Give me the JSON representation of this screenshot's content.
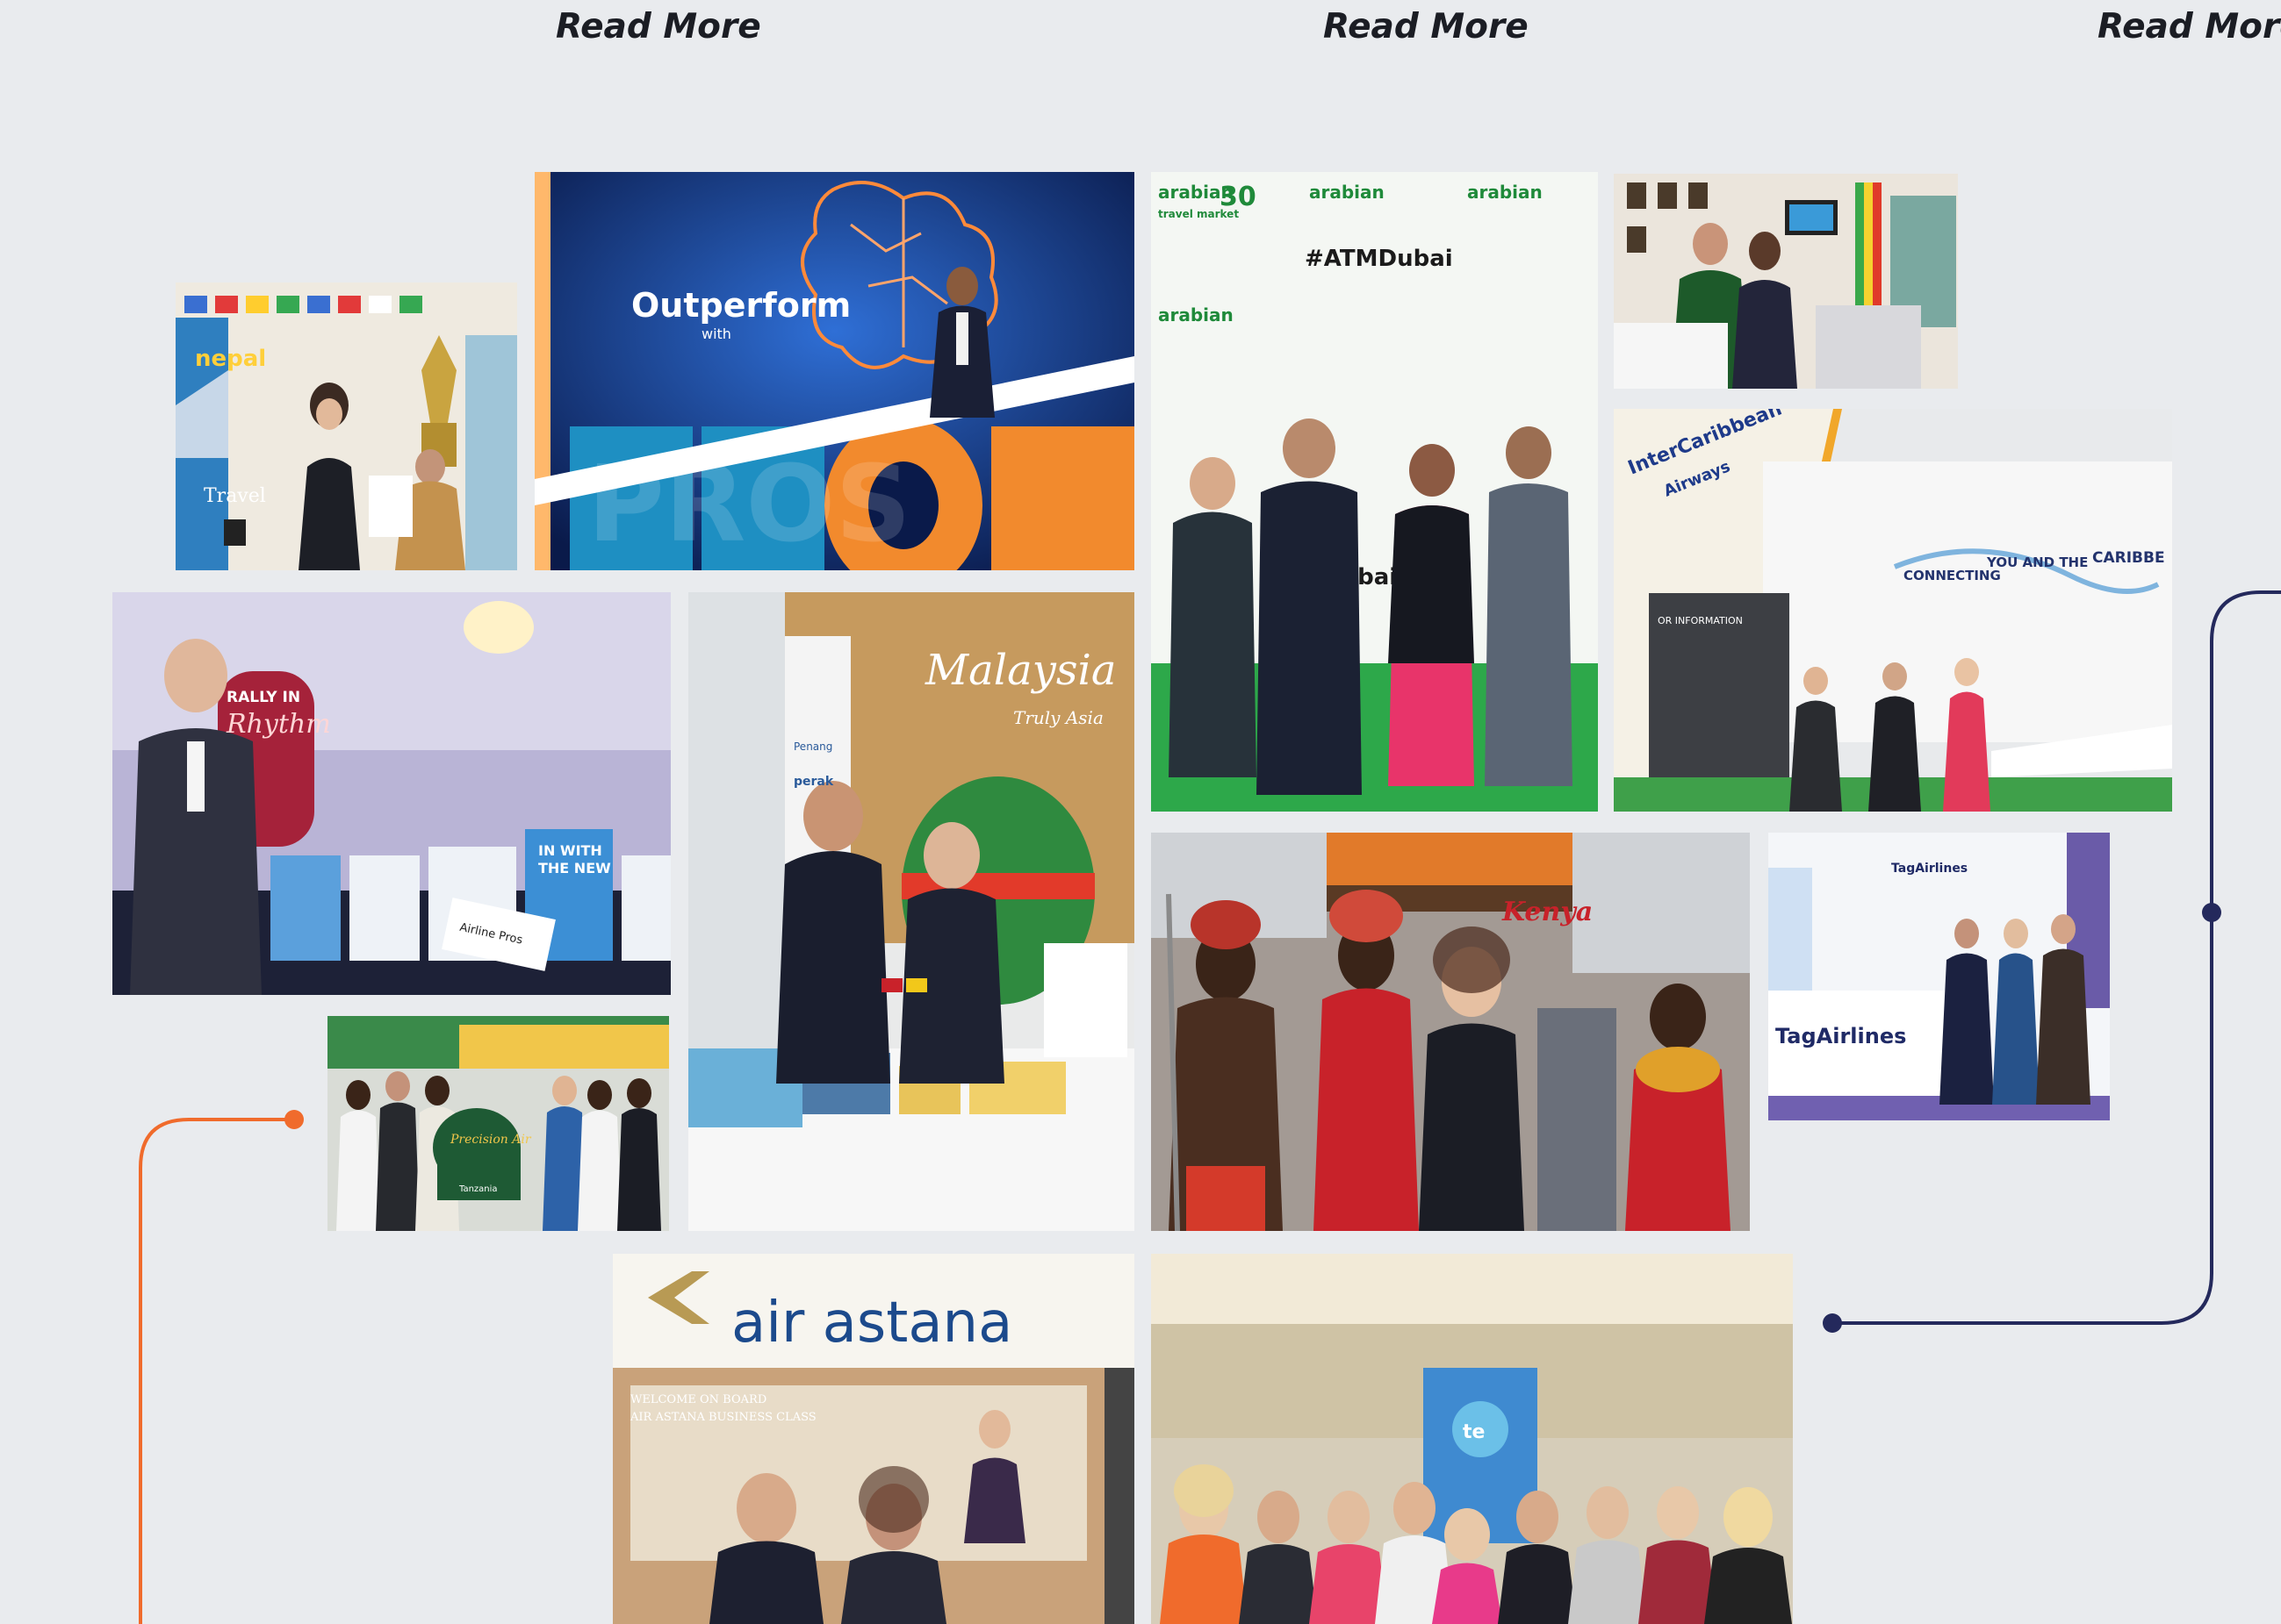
{
  "read_more_links": [
    {
      "label": "Read More"
    },
    {
      "label": "Read More"
    },
    {
      "label": "Read More"
    }
  ],
  "photos": {
    "nepal_booth": {
      "signage": [
        "nepal",
        "Travel"
      ]
    },
    "outperform_pros": {
      "signage": [
        "Outperform",
        "with",
        "PROS"
      ]
    },
    "arabian_travel_market": {
      "signage": [
        "arabian",
        "travel market",
        "30",
        "#ATMDubai",
        "Dubai"
      ]
    },
    "flags_booth": {
      "signage": []
    },
    "intercaribbean": {
      "signage": [
        "InterCaribbean",
        "Airways",
        "CONNECTING",
        "YOU AND THE",
        "CARIBBE",
        "OR INFORMATION"
      ]
    },
    "rally_rhythm": {
      "signage": [
        "RALLY IN",
        "Rhythm",
        "IN WITH",
        "THE NEW",
        "Airline Pros"
      ]
    },
    "malaysia_booth": {
      "signage": [
        "Malaysia",
        "Truly Asia",
        "perak",
        "Penang"
      ]
    },
    "kenya_warriors": {
      "signage": [
        "Kenya"
      ]
    },
    "tag_airlines": {
      "signage": [
        "TagAirlines",
        "TagAirlines"
      ]
    },
    "precision_air": {
      "signage": [
        "Precision Air",
        "Tanzania"
      ]
    },
    "air_astana": {
      "signage": [
        "air astana",
        "WELCOME ON BOARD",
        "AIR ASTANA BUSINESS CLASS"
      ]
    },
    "group_celebration": {
      "signage": [
        "te"
      ]
    }
  },
  "colors": {
    "background": "#e9ebee",
    "orange_connector": "#f06b2c",
    "navy_connector": "#24295c"
  }
}
